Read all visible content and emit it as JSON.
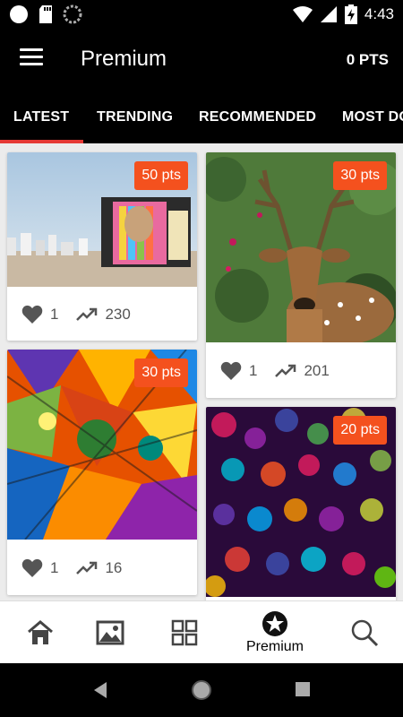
{
  "status_bar": {
    "time": "4:43"
  },
  "app_bar": {
    "title": "Premium",
    "points": "0 PTS"
  },
  "tabs": [
    {
      "label": "LATEST"
    },
    {
      "label": "TRENDING"
    },
    {
      "label": "RECOMMENDED"
    },
    {
      "label": "MOST DO"
    }
  ],
  "cards": [
    {
      "points": "50 pts",
      "likes": "1",
      "views": "230"
    },
    {
      "points": "30 pts",
      "likes": "1",
      "views": "201"
    },
    {
      "points": "30 pts",
      "likes": "1",
      "views": "16"
    },
    {
      "points": "20 pts"
    }
  ],
  "bottom_nav": {
    "premium_label": "Premium"
  },
  "colors": {
    "accent": "#f4511e",
    "tab_indicator": "#e53935",
    "bar": "#000000"
  }
}
